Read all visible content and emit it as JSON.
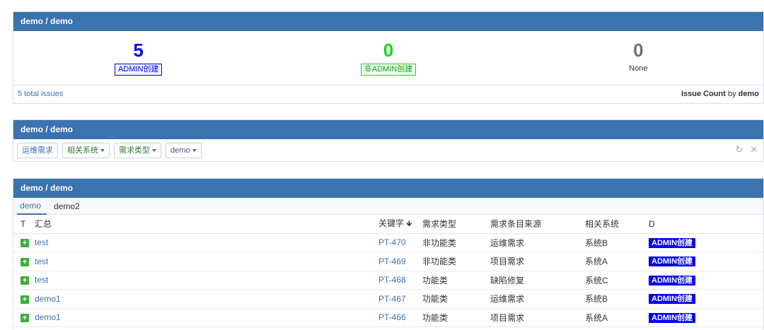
{
  "panel1": {
    "title": "demo / demo",
    "stats": [
      {
        "count": "5",
        "label": "ADMIN创建"
      },
      {
        "count": "0",
        "label": "非ADMIN创建"
      },
      {
        "count": "0",
        "label": "None"
      }
    ],
    "total": "5 total issues",
    "footer_label": "Issue Count",
    "footer_by": "by",
    "footer_field": "demo"
  },
  "panel2": {
    "title": "demo / demo",
    "filters": [
      {
        "label": "运维需求"
      },
      {
        "label": "相关系统"
      },
      {
        "label": "需求类型"
      },
      {
        "label": "demo"
      }
    ],
    "refresh_icon": "refresh-icon",
    "close_icon": "close-icon"
  },
  "panel3": {
    "title": "demo / demo",
    "tabs": [
      "demo",
      "demo2"
    ],
    "columns": {
      "t": "T",
      "summary": "汇总",
      "key": "关键字",
      "type": "需求类型",
      "source": "需求条目来源",
      "system": "相关系统",
      "d": "D"
    },
    "rows": [
      {
        "summary": "test",
        "key": "PT-470",
        "type": "非功能类",
        "source": "运维需求",
        "system": "系统B",
        "d": "ADMIN创建"
      },
      {
        "summary": "test",
        "key": "PT-469",
        "type": "非功能类",
        "source": "项目需求",
        "system": "系统A",
        "d": "ADMIN创建"
      },
      {
        "summary": "test",
        "key": "PT-468",
        "type": "功能类",
        "source": "缺陷修复",
        "system": "系统C",
        "d": "ADMIN创建"
      },
      {
        "summary": "demo1",
        "key": "PT-467",
        "type": "功能类",
        "source": "运维需求",
        "system": "系统B",
        "d": "ADMIN创建"
      },
      {
        "summary": "demo1",
        "key": "PT-466",
        "type": "功能类",
        "source": "项目需求",
        "system": "系统A",
        "d": "ADMIN创建"
      }
    ]
  },
  "colors": {
    "header_bg": "#3b73af",
    "admin_blue": "#0000ee",
    "non_admin_green": "#22d122",
    "none_gray": "#707070"
  }
}
